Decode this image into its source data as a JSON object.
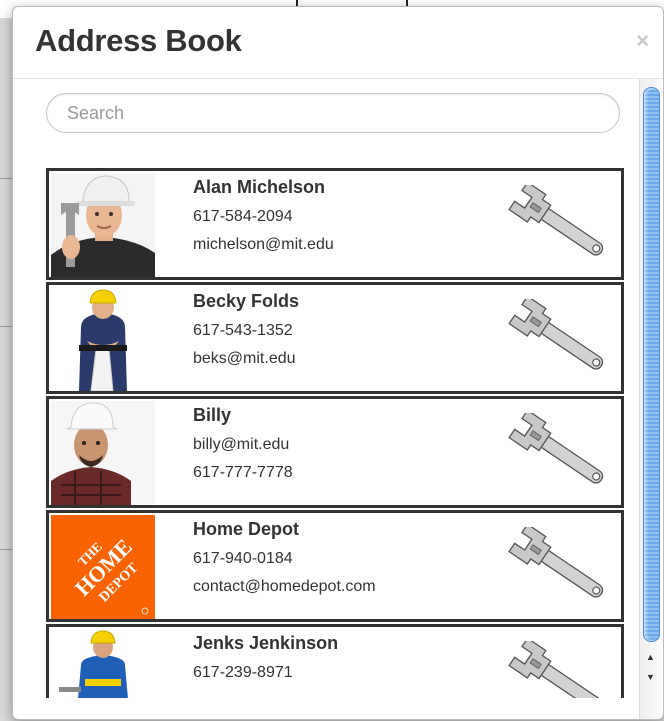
{
  "modal": {
    "title": "Address Book",
    "close_label": "×"
  },
  "search": {
    "placeholder": "Search",
    "value": ""
  },
  "contacts": [
    {
      "name": "Alan Michelson",
      "line1": "617-584-2094",
      "line2": "michelson@mit.edu",
      "photo": "worker-hardhat-wrench-photo"
    },
    {
      "name": "Becky Folds",
      "line1": "617-543-1352",
      "line2": "beks@mit.edu",
      "photo": "worker-yellow-helmet-photo"
    },
    {
      "name": "Billy",
      "line1": "billy@mit.edu",
      "line2": "617-777-7778",
      "photo": "worker-white-hardhat-photo"
    },
    {
      "name": "Home Depot",
      "line1": "617-940-0184",
      "line2": "contact@homedepot.com",
      "photo": "home-depot-logo"
    },
    {
      "name": "Jenks Jenkinson",
      "line1": "617-239-8971",
      "line2": "",
      "photo": "worker-blue-overalls-photo"
    }
  ],
  "icons": {
    "edit": "wrench-icon",
    "scroll_up": "arrow-up-icon",
    "scroll_down": "arrow-down-icon"
  },
  "colors": {
    "scroll_thumb": "#6aa6ea",
    "home_depot_orange": "#f96302",
    "contact_border": "#333333"
  }
}
